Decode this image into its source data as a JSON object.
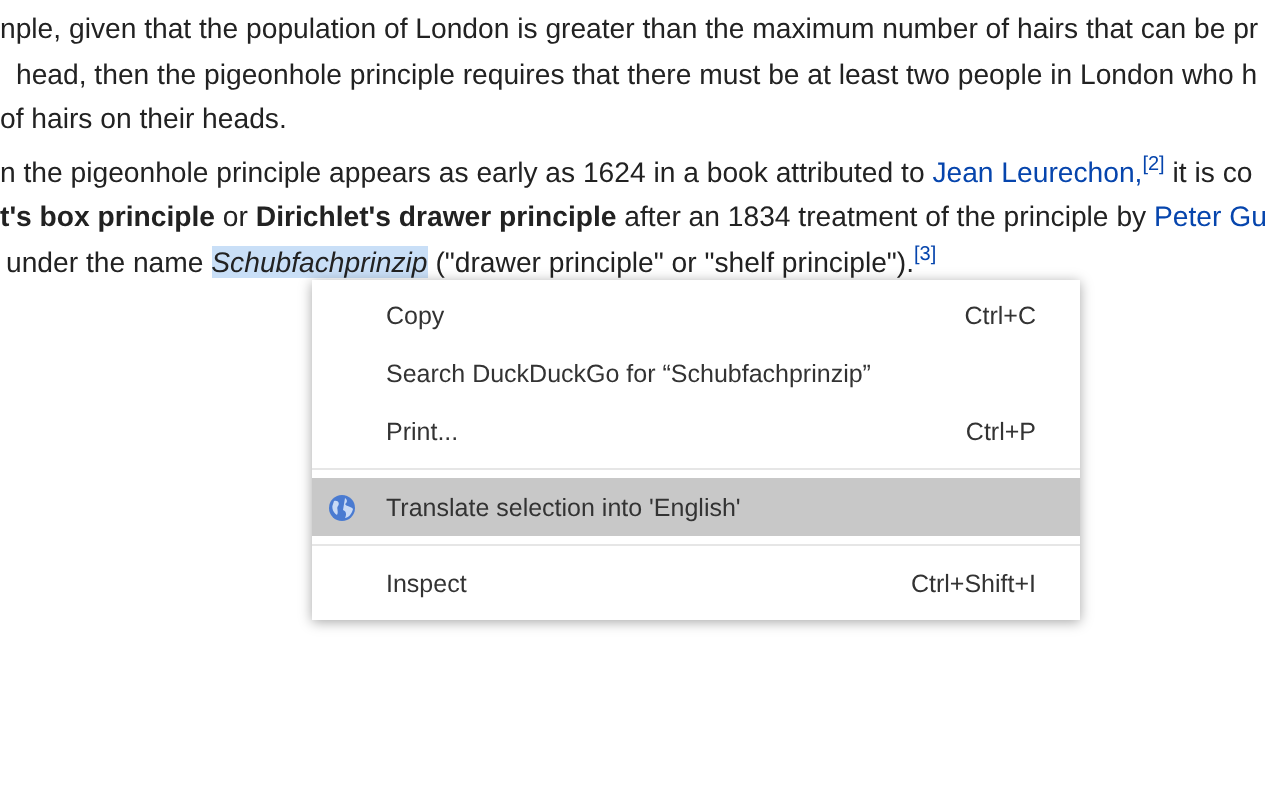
{
  "article": {
    "paragraphs": [
      {
        "lines": [
          [
            {
              "kind": "text",
              "text": "nple, given that the population of London is greater than the maximum number of hairs that can be pr"
            }
          ],
          [
            {
              "kind": "text",
              "text": "head, then the pigeonhole principle requires that there must be at least two people in London who h"
            }
          ],
          [
            {
              "kind": "text",
              "text": "of hairs on their heads."
            }
          ]
        ]
      },
      {
        "lines": [
          [
            {
              "kind": "text",
              "text": "n the pigeonhole principle appears as early as 1624 in a book attributed to "
            },
            {
              "kind": "link",
              "text": "Jean Leurechon,"
            },
            {
              "kind": "cite",
              "text": "[2]"
            },
            {
              "kind": "text",
              "text": " it is co"
            }
          ],
          [
            {
              "kind": "text",
              "text": "**t's box principle** or **Dirichlet's drawer principle** after an 1834 treatment of the principle by "
            },
            {
              "kind": "link",
              "text": "Peter Gu"
            }
          ],
          [
            {
              "kind": "text",
              "text": "under the name "
            },
            {
              "kind": "selection",
              "text": "Schubfachprinzip"
            },
            {
              "kind": "text",
              "text": " (\"drawer principle\" or \"shelf principle\")."
            },
            {
              "kind": "cite",
              "text": "[3]"
            }
          ]
        ]
      }
    ]
  },
  "context_menu": {
    "items": [
      {
        "kind": "item",
        "label": "Copy",
        "shortcut": "Ctrl+C",
        "selected": false
      },
      {
        "kind": "item",
        "label": "Search DuckDuckGo for “Schubfachprinzip”",
        "selected": false
      },
      {
        "kind": "item",
        "label": "Print...",
        "shortcut": "Ctrl+P",
        "selected": false
      },
      {
        "kind": "separator"
      },
      {
        "kind": "iconitem",
        "label": "Translate selection into 'English'",
        "selected": true
      },
      {
        "kind": "separator"
      },
      {
        "kind": "item",
        "label": "Inspect",
        "shortcut": "Ctrl+Shift+I",
        "selected": false
      }
    ]
  }
}
